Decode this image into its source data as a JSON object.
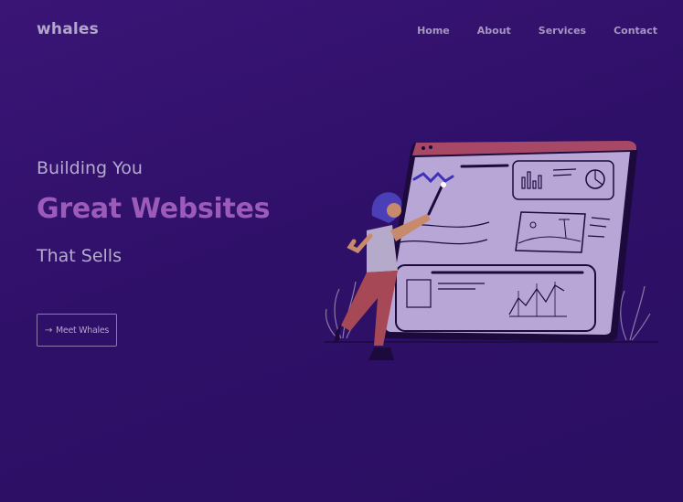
{
  "header": {
    "logo": "whales",
    "nav": [
      {
        "label": "Home"
      },
      {
        "label": "About"
      },
      {
        "label": "Services"
      },
      {
        "label": "Contact"
      }
    ]
  },
  "hero": {
    "line1": "Building You",
    "line2": "Great Websites",
    "line3": "That Sells",
    "cta_icon": "arrow-right-icon",
    "cta_label": "Meet Whales"
  },
  "colors": {
    "background": "#2f1069",
    "accent": "#9c5bb8",
    "text": "#b6aacd",
    "illustration_screen": "#b8a7d6",
    "illustration_frame": "#a74867"
  }
}
